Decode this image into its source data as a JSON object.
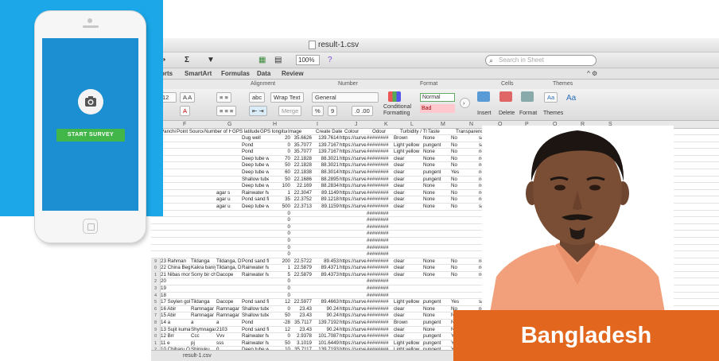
{
  "window": {
    "title": "result-1.csv"
  },
  "toolbar": {
    "zoom": "100%",
    "search_placeholder": "Search in Sheet"
  },
  "ribbon": {
    "tabs": [
      "orts",
      "SmartArt",
      "Formulas",
      "Data",
      "Review"
    ],
    "groups": [
      "Alignment",
      "Number",
      "Format",
      "Cells",
      "Themes"
    ],
    "font_size": "12",
    "abc_label": "abc",
    "wrap_text": "Wrap Text",
    "merge": "Merge",
    "number_format": "General",
    "percent": "%",
    "comma": "9",
    "conditional_formatting": "Conditional Formatting",
    "style_normal": "Normal",
    "style_bad": "Bad",
    "insert": "Insert",
    "delete": "Delete",
    "format": "Format",
    "themes": "Themes"
  },
  "columns": [
    "F",
    "G",
    "H",
    "I",
    "J",
    "K",
    "L",
    "M",
    "N",
    "O",
    "P",
    "Q",
    "R",
    "S"
  ],
  "headers": [
    "Panchi",
    "Point Source",
    "Number of H",
    "GPS latitude",
    "GPS longitud",
    "Image",
    "Create Date",
    "Colour",
    "Odour",
    "Turbidity / Tl",
    "Taste",
    "Transparenc"
  ],
  "rows_top": [
    {
      "d": "Dug well",
      "e": "20",
      "f": "35.6626",
      "g": "139.7614",
      "h": "https://surve",
      "i": "########",
      "j": "Brown",
      "k": "None",
      "l": "No",
      "m": "salt",
      "n": "Not clear"
    },
    {
      "d": "Pond",
      "e": "0",
      "f": "35.7077",
      "g": "139.7167",
      "h": "https://surve",
      "i": "########",
      "j": "Light yellow",
      "k": "pungent",
      "l": "No",
      "m": "salt",
      "n": "Not clear"
    },
    {
      "d": "Pond",
      "e": "0",
      "f": "35.7077",
      "g": "139.7167",
      "h": "https://surve",
      "i": "########",
      "j": "Light yellow",
      "k": "None",
      "l": "No",
      "m": "normal",
      "n": "clear"
    },
    {
      "d": "Deep tube w",
      "e": "70",
      "f": "22.1828",
      "g": "88.3021",
      "h": "https://surve",
      "i": "########",
      "j": "clear",
      "k": "None",
      "l": "No",
      "m": "normal",
      "n": "clear"
    },
    {
      "d": "Deep tube w",
      "e": "50",
      "f": "22.1828",
      "g": "88.3021",
      "h": "https://surve",
      "i": "########",
      "j": "clear",
      "k": "None",
      "l": "No",
      "m": "normal",
      "n": "clear"
    },
    {
      "d": "Deep tube w",
      "e": "60",
      "f": "22.1838",
      "g": "88.3014",
      "h": "https://surve",
      "i": "########",
      "j": "clear",
      "k": "pungent",
      "l": "Yes",
      "m": "normal",
      "n": "clear"
    },
    {
      "d": "Shallow tube",
      "e": "50",
      "f": "22.1686",
      "g": "88.2895",
      "h": "https://surve",
      "i": "########",
      "j": "clear",
      "k": "pungent",
      "l": "No",
      "m": "normal",
      "n": "Not clear"
    },
    {
      "d": "Deep tube w",
      "e": "100",
      "f": "22.169",
      "g": "88.2834",
      "h": "https://surve",
      "i": "########",
      "j": "clear",
      "k": "None",
      "l": "No",
      "m": "normal",
      "n": "clear"
    },
    {
      "c": "agar s",
      "d": "Rainwater ha",
      "e": "1",
      "f": "22.3047",
      "g": "89.1149",
      "h": "https://surve",
      "i": "########",
      "j": "clear",
      "k": "None",
      "l": "No",
      "m": "normal",
      "n": "clear"
    },
    {
      "c": "agar u",
      "d": "Pond sand fil",
      "e": "35",
      "f": "22.3752",
      "g": "89.1218",
      "h": "https://surve",
      "i": "########",
      "j": "clear",
      "k": "None",
      "l": "No",
      "m": "normal",
      "n": "clear"
    },
    {
      "c": "agar u",
      "d": "Deep tube w",
      "e": "500",
      "f": "22.3713",
      "g": "89.1159",
      "h": "https://surve",
      "i": "########",
      "j": "clear",
      "k": "None",
      "l": "No",
      "m": "salt",
      "n": "clear"
    },
    {
      "e": "0",
      "i": "########"
    },
    {
      "e": "0",
      "i": "########"
    },
    {
      "e": "0",
      "i": "########"
    },
    {
      "e": "0",
      "i": "########"
    },
    {
      "e": "0",
      "i": "########"
    },
    {
      "e": "0",
      "i": "########"
    },
    {
      "e": "0",
      "i": "########"
    }
  ],
  "rows_bottom": [
    {
      "r": "9",
      "a": "23 Rahman",
      "b": "Tildanga",
      "c": "Tildanga, Dar",
      "d": "Pond sand fil",
      "e": "200",
      "f": "22.5722",
      "g": "89.453",
      "h": "https://surve",
      "i": "########",
      "j": "clear",
      "k": "None",
      "l": "No",
      "m": "normal",
      "n": "clear"
    },
    {
      "r": "0",
      "a": "22 China Begam",
      "b": "Kakra baniya",
      "c": "Tildanga, Dar",
      "d": "Rainwater ha",
      "e": "1",
      "f": "22.5879",
      "g": "89.4371",
      "h": "https://surve",
      "i": "########",
      "j": "clear",
      "k": "None",
      "l": "No",
      "m": "normal",
      "n": "clear"
    },
    {
      "r": "1",
      "a": "21 Nibas mondal",
      "b": "Sorry bir cha",
      "c": "Dacope",
      "d": "Rainwater ha",
      "e": "5",
      "f": "22.5879",
      "g": "89.4373",
      "h": "https://surve",
      "i": "########",
      "j": "clear",
      "k": "None",
      "l": "No",
      "m": "normal",
      "n": "clear"
    },
    {
      "r": "2",
      "a": "20",
      "e": "0",
      "i": "########"
    },
    {
      "r": "3",
      "a": "19",
      "e": "0",
      "i": "########"
    },
    {
      "r": "4",
      "a": "18",
      "e": "0",
      "i": "########"
    },
    {
      "r": "5",
      "a": "17 Soylen golder",
      "b": "Tildanga",
      "c": "Dacope",
      "d": "Pond sand fil",
      "e": "12",
      "f": "22.5977",
      "g": "89.4663",
      "h": "https://surve",
      "i": "########",
      "j": "Light yellow",
      "k": "pungent",
      "l": "Yes",
      "m": "salt",
      "n": "Not clear"
    },
    {
      "r": "6",
      "a": "16 Abir",
      "b": "Ramnagar",
      "c": "Ramnagar",
      "d": "Shallow tube",
      "e": "0",
      "f": "23.43",
      "g": "90.24",
      "h": "https://surve",
      "i": "########",
      "j": "clear",
      "k": "None",
      "l": "No",
      "m": "normal",
      "n": "clear"
    },
    {
      "r": "7",
      "a": "15 Abir",
      "b": "Ramnagar",
      "c": "Ramnagar",
      "d": "Shallow tube",
      "e": "50",
      "f": "23.43",
      "g": "90.24",
      "h": "https://surve",
      "i": "########",
      "j": "clear",
      "k": "None",
      "l": "No",
      "m": "normal",
      "n": "clear"
    },
    {
      "r": "8",
      "a": "14 a",
      "b": "a",
      "c": "a",
      "d": "Pond",
      "e": "-28",
      "f": "35.7117",
      "g": "139.7192",
      "h": "https://surve",
      "i": "########",
      "j": "Brown",
      "k": "pungent",
      "l": "No",
      "m": "normal",
      "n": "Not clear"
    },
    {
      "r": "9",
      "a": "13 Sujit kumar",
      "b": "Shymnagar",
      "c": "2103",
      "d": "Pond sand fil",
      "e": "12",
      "f": "23.43",
      "g": "90.24",
      "h": "https://surve",
      "i": "########",
      "j": "clear",
      "k": "None",
      "l": "No",
      "m": "normal",
      "n": "clear"
    },
    {
      "r": "0",
      "a": "12 Brr",
      "b": "Ccc",
      "c": "Vvv",
      "d": "Rainwater ha",
      "e": "0",
      "f": "2.9378",
      "g": "101.7087",
      "h": "https://surve",
      "i": "########",
      "j": "clear",
      "k": "pungent",
      "l": "Yes",
      "m": "salt",
      "n": ""
    },
    {
      "r": "1",
      "a": "11 e",
      "b": "pj",
      "c": "sss",
      "d": "Rainwater ha",
      "e": "50",
      "f": "3.1019",
      "g": "101.6449",
      "h": "https://surve",
      "i": "########",
      "j": "Light yellow",
      "k": "pungent",
      "l": "Yes",
      "m": "salt",
      "n": ""
    },
    {
      "r": "2",
      "a": "10 Chiharu OYA",
      "b": "Shinjuku",
      "c": "0",
      "d": "Deep tube w",
      "e": "10",
      "f": "35.7117",
      "g": "139.7193",
      "h": "https://surve",
      "i": "########",
      "j": "Light yellow",
      "k": "pungent",
      "l": "Yes",
      "m": "normal",
      "n": ""
    }
  ],
  "sheet_tab": "result-1.csv",
  "phone": {
    "button_label": "START SURVEY"
  },
  "banner": {
    "country": "Bangladesh",
    "color": "#e2661d"
  },
  "colors": {
    "phone_bg": "#1ba7e8",
    "screen": "#1c8fd3",
    "button": "#43b649"
  }
}
